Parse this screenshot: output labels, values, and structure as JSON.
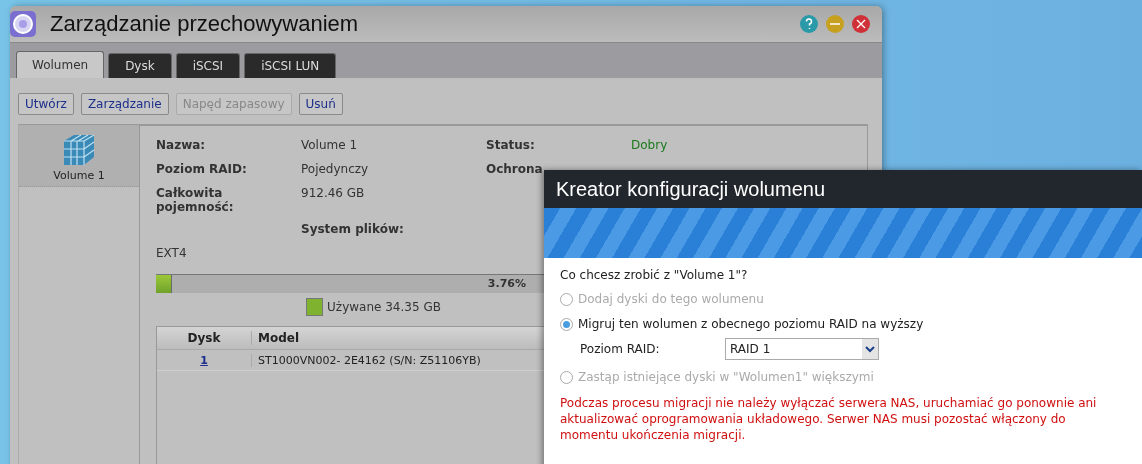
{
  "window": {
    "title": "Zarządzanie przechowywaniem"
  },
  "tabs": [
    {
      "label": "Wolumen",
      "selected": true
    },
    {
      "label": "Dysk",
      "selected": false
    },
    {
      "label": "iSCSI",
      "selected": false
    },
    {
      "label": "iSCSI LUN",
      "selected": false
    }
  ],
  "toolbar": [
    {
      "label": "Utwórz",
      "disabled": false
    },
    {
      "label": "Zarządzanie",
      "disabled": false
    },
    {
      "label": "Napęd zapasowy",
      "disabled": true
    },
    {
      "label": "Usuń",
      "disabled": false
    }
  ],
  "sidebar": {
    "items": [
      {
        "label": "Volume 1",
        "selected": true
      }
    ]
  },
  "info_rows": [
    [
      {
        "kind": "label",
        "text": "Nazwa:"
      },
      {
        "kind": "value",
        "text": "Volume 1"
      },
      {
        "kind": "label",
        "text": "Status:"
      },
      {
        "kind": "good",
        "text": "Dobry"
      }
    ],
    [
      {
        "kind": "label",
        "text": "Poziom RAID:"
      },
      {
        "kind": "value",
        "text": "Pojedynczy"
      },
      {
        "kind": "label",
        "text": "Ochrona"
      }
    ],
    [
      {
        "kind": "label",
        "text": "Całkowita pojemność:"
      },
      {
        "kind": "value",
        "text": "912.46 GB"
      }
    ],
    [
      {
        "kind": "gap"
      },
      {
        "kind": "label",
        "text": "System plików:"
      }
    ],
    [
      {
        "kind": "value",
        "text": "EXT4"
      }
    ]
  ],
  "usage": {
    "level": 0.0376,
    "percent": "3.76%",
    "legend": "Używane 34.35 GB"
  },
  "table": {
    "columns": [
      "Dysk",
      "Model"
    ],
    "rows": [
      [
        "1",
        "ST1000VN002- 2E4162 (S/N: Z51106YB)"
      ]
    ]
  },
  "dialog": {
    "title": "Kreator konfiguracji wolumenu",
    "question": "Co chcesz zrobić z \"Volume 1\"?",
    "options": [
      {
        "label": "Dodaj dyski do tego wolumenu",
        "selected": false,
        "disabled": true
      },
      {
        "label": "Migruj ten wolumen z obecnego poziomu RAID na wyższy",
        "selected": true,
        "disabled": false
      },
      {
        "label": "Zastąp istniejące dyski w \"Wolumen1\" większymi",
        "selected": false,
        "disabled": true
      }
    ],
    "raid_field": {
      "label": "Poziom RAID:",
      "value": "RAID 1"
    },
    "warning": "Podczas procesu migracji nie należy wyłączać serwera NAS, uruchamiać go ponownie ani aktualizować oprogramowania układowego. Serwer NAS musi pozostać włączony do momentu ukończenia migracji."
  }
}
